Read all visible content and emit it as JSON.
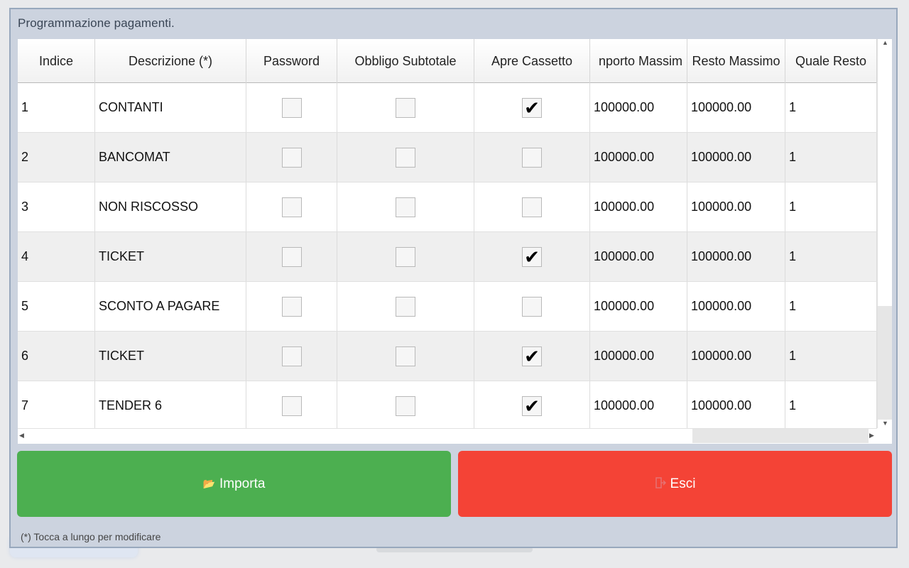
{
  "dialog": {
    "title": "Programmazione pagamenti.",
    "footnote": "(*) Tocca a lungo per modificare"
  },
  "table": {
    "columns": [
      "Indice",
      "Descrizione (*)",
      "Password",
      "Obbligo Subtotale",
      "Apre Cassetto",
      "Importo Massimo",
      "Resto Massimo",
      "Quale Resto"
    ],
    "columns_visible": [
      "Indice",
      "Descrizione (*)",
      "Password",
      "Obbligo Subtotale",
      "Apre Cassetto",
      "nporto Massim",
      "Resto Massimo",
      "Quale Resto"
    ],
    "rows": [
      {
        "indice": "1",
        "descrizione": "CONTANTI",
        "password": false,
        "obbligo_subtotale": false,
        "apre_cassetto": true,
        "importo_massimo": "100000.00",
        "resto_massimo": "100000.00",
        "quale_resto": "1"
      },
      {
        "indice": "2",
        "descrizione": "BANCOMAT",
        "password": false,
        "obbligo_subtotale": false,
        "apre_cassetto": false,
        "importo_massimo": "100000.00",
        "resto_massimo": "100000.00",
        "quale_resto": "1"
      },
      {
        "indice": "3",
        "descrizione": "NON RISCOSSO",
        "password": false,
        "obbligo_subtotale": false,
        "apre_cassetto": false,
        "importo_massimo": "100000.00",
        "resto_massimo": "100000.00",
        "quale_resto": "1"
      },
      {
        "indice": "4",
        "descrizione": "TICKET",
        "password": false,
        "obbligo_subtotale": false,
        "apre_cassetto": true,
        "importo_massimo": "100000.00",
        "resto_massimo": "100000.00",
        "quale_resto": "1"
      },
      {
        "indice": "5",
        "descrizione": "SCONTO A PAGARE",
        "password": false,
        "obbligo_subtotale": false,
        "apre_cassetto": false,
        "importo_massimo": "100000.00",
        "resto_massimo": "100000.00",
        "quale_resto": "1"
      },
      {
        "indice": "6",
        "descrizione": "TICKET",
        "password": false,
        "obbligo_subtotale": false,
        "apre_cassetto": true,
        "importo_massimo": "100000.00",
        "resto_massimo": "100000.00",
        "quale_resto": "1"
      },
      {
        "indice": "7",
        "descrizione": "TENDER 6",
        "password": false,
        "obbligo_subtotale": false,
        "apre_cassetto": true,
        "importo_massimo": "100000.00",
        "resto_massimo": "100000.00",
        "quale_resto": "1"
      }
    ]
  },
  "buttons": {
    "import_label": "Importa",
    "import_icon": "folder-icon",
    "exit_label": "Esci",
    "exit_icon": "exit-door-icon"
  },
  "colors": {
    "import_button": "#4caf50",
    "exit_button": "#f44336",
    "dialog_background": "#ccd3df"
  }
}
